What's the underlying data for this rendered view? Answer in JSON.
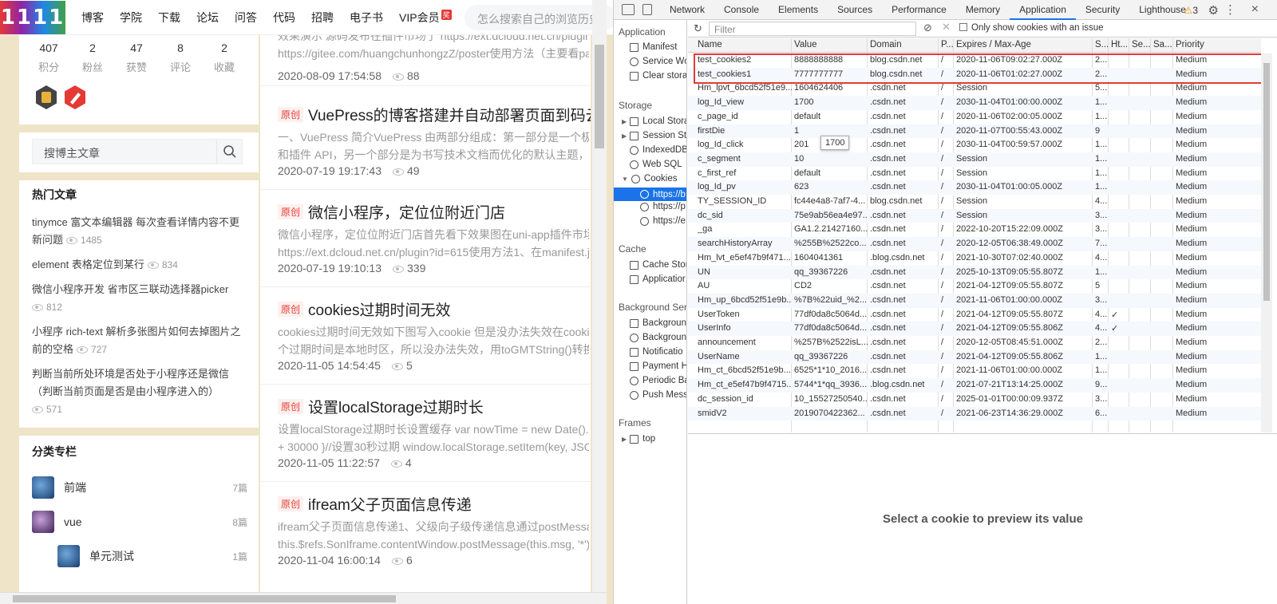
{
  "blog": {
    "logo": "1111",
    "nav": [
      "博客",
      "学院",
      "下载",
      "论坛",
      "问答",
      "代码",
      "招聘",
      "电子书",
      "VIP会员"
    ],
    "vip_badge": "奖",
    "search_placeholder": "怎么搜索自己的浏览历史",
    "stats": [
      {
        "num": "407",
        "label": "积分"
      },
      {
        "num": "2",
        "label": "粉丝"
      },
      {
        "num": "47",
        "label": "获赞"
      },
      {
        "num": "8",
        "label": "评论"
      },
      {
        "num": "2",
        "label": "收藏"
      }
    ],
    "author_search_placeholder": "搜博主文章",
    "hot_title": "热门文章",
    "hot": [
      {
        "title": "tinymce 富文本编辑器 每次查看详情内容不更新问题",
        "views": "1485"
      },
      {
        "title": "element 表格定位到某行",
        "views": "834"
      },
      {
        "title": "微信小程序开发 省市区三联动选择器picker",
        "views": "812"
      },
      {
        "title": "小程序 rich-text 解析多张图片如何去掉图片之前的空格",
        "views": "727"
      },
      {
        "title": "判断当前所处环境是否处于小程序还是微信（判断当前页面是否是由小程序进入的）",
        "views": "571"
      }
    ],
    "cat_title": "分类专栏",
    "cats": [
      {
        "name": "前端",
        "count": "7篇"
      },
      {
        "name": "vue",
        "count": "8篇"
      },
      {
        "name": "单元测试",
        "count": "1篇"
      }
    ],
    "original_tag": "原创",
    "articles": [
      {
        "title": "",
        "desc1": "效果演示 源码发布在插件市场了 https://ext.dcloud.net.cn/plugin",
        "desc2": "https://gitee.com/huangchunhongzZ/poster使用方法（主要看pa",
        "date": "2020-08-09 17:54:58",
        "views": "88"
      },
      {
        "title": "VuePress的博客搭建并自动部署页面到码云",
        "desc1": "一、VuePress 简介VuePress 由两部分组成：第一部分是一个极",
        "desc2": "和插件 API，另一个部分是为书写技术文档而优化的默认主题，1",
        "date": "2020-07-19 19:17:43",
        "views": "49"
      },
      {
        "title": "微信小程序，定位位附近门店",
        "desc1": "微信小程序，定位位附近门店首先看下效果图在uni-app插件市场",
        "desc2": "https://ext.dcloud.net.cn/plugin?id=615使用方法1、在manifest.js",
        "date": "2020-07-19 19:10:13",
        "views": "339"
      },
      {
        "title": "cookies过期时间无效",
        "desc1": "cookies过期时间无效如下图写入cookie 但是没办法失效在cookie",
        "desc2": "个过期时间是本地时区，所以没办法失效，用toGMTString()转换",
        "date": "2020-11-05 14:54:45",
        "views": "5"
      },
      {
        "title": "设置localStorage过期时长",
        "desc1": "设置localStorage过期时长设置缓存 var nowTime = new Date().g",
        "desc2": "+ 30000 }//设置30秒过期 window.localStorage.setItem(key, JSO",
        "date": "2020-11-05 11:22:57",
        "views": "4"
      },
      {
        "title": "ifream父子页面信息传递",
        "desc1": "ifream父子页面信息传递1、父级向子级传递信息通过postMessa",
        "desc2": "this.$refs.SonIframe.contentWindow.postMessage(this.msg, '*')",
        "date": "2020-11-04 16:00:14",
        "views": "6"
      }
    ]
  },
  "devtools": {
    "tabs": [
      "Network",
      "Console",
      "Elements",
      "Sources",
      "Performance",
      "Memory",
      "Application",
      "Security",
      "Lighthouse"
    ],
    "selected_tab": "Application",
    "warnings": "3",
    "sidebar": {
      "application": "Application",
      "manifest": "Manifest",
      "service_workers": "Service Wo",
      "clear_storage": "Clear stora",
      "storage": "Storage",
      "local_storage": "Local Stora",
      "session_storage": "Session Sto",
      "indexeddb": "IndexedDB",
      "websql": "Web SQL",
      "cookies": "Cookies",
      "cookie_site1": "https://b",
      "cookie_site2": "https://p",
      "cookie_site3": "https://e",
      "cache": "Cache",
      "cache_storage": "Cache Stor",
      "app_cache": "Applicatior",
      "background": "Background Servi",
      "bg_fetch": "Backgroun",
      "bg_sync": "Backgroun",
      "notifications": "Notificatio",
      "payment": "Payment H",
      "periodic": "Periodic Ba",
      "push": "Push Messa",
      "frames": "Frames",
      "top": "top"
    },
    "filter_placeholder": "Filter",
    "only_issue": "Only show cookies with an issue",
    "columns": [
      "Name",
      "Value",
      "Domain",
      "P...",
      "Expires / Max-Age",
      "S...",
      "Ht...",
      "Se...",
      "Sa...",
      "Priority"
    ],
    "cookies": [
      [
        "test_cookies2",
        "8888888888",
        "blog.csdn.net",
        "/",
        "2020-11-06T09:02:27.000Z",
        "2...",
        "",
        "",
        "",
        "Medium"
      ],
      [
        "test_cookies1",
        "7777777777",
        "blog.csdn.net",
        "/",
        "2020-11-06T01:02:27.000Z",
        "2...",
        "",
        "",
        "",
        "Medium"
      ],
      [
        "Hm_lpvt_6bcd52f51e9...",
        "1604624406",
        ".csdn.net",
        "/",
        "Session",
        "5...",
        "",
        "",
        "",
        "Medium"
      ],
      [
        "log_Id_view",
        "1700",
        ".csdn.net",
        "/",
        "2030-11-04T01:00:00.000Z",
        "1...",
        "",
        "",
        "",
        "Medium"
      ],
      [
        "c_page_id",
        "default",
        ".csdn.net",
        "/",
        "2020-11-06T02:00:05.000Z",
        "1...",
        "",
        "",
        "",
        "Medium"
      ],
      [
        "firstDie",
        "1",
        ".csdn.net",
        "/",
        "2020-11-07T00:55:43.000Z",
        "9",
        "",
        "",
        "",
        "Medium"
      ],
      [
        "log_Id_click",
        "201",
        ".csdn.net",
        "/",
        "2030-11-04T00:59:57.000Z",
        "1...",
        "",
        "",
        "",
        "Medium"
      ],
      [
        "c_segment",
        "10",
        ".csdn.net",
        "/",
        "Session",
        "1...",
        "",
        "",
        "",
        "Medium"
      ],
      [
        "c_first_ref",
        "default",
        ".csdn.net",
        "/",
        "Session",
        "1...",
        "",
        "",
        "",
        "Medium"
      ],
      [
        "log_Id_pv",
        "623",
        ".csdn.net",
        "/",
        "2030-11-04T01:00:05.000Z",
        "1...",
        "",
        "",
        "",
        "Medium"
      ],
      [
        "TY_SESSION_ID",
        "fc44e4a8-7af7-4...",
        "blog.csdn.net",
        "/",
        "Session",
        "4...",
        "",
        "",
        "",
        "Medium"
      ],
      [
        "dc_sid",
        "75e9ab56ea4e97...",
        ".csdn.net",
        "/",
        "Session",
        "3...",
        "",
        "",
        "",
        "Medium"
      ],
      [
        "_ga",
        "GA1.2.21427160...",
        ".csdn.net",
        "/",
        "2022-10-20T15:22:09.000Z",
        "3...",
        "",
        "",
        "",
        "Medium"
      ],
      [
        "searchHistoryArray",
        "%255B%2522co...",
        ".csdn.net",
        "/",
        "2020-12-05T06:38:49.000Z",
        "7...",
        "",
        "",
        "",
        "Medium"
      ],
      [
        "Hm_lvt_e5ef47b9f471...",
        "1604041361",
        ".blog.csdn.net",
        "/",
        "2021-10-30T07:02:40.000Z",
        "4...",
        "",
        "",
        "",
        "Medium"
      ],
      [
        "UN",
        "qq_39367226",
        ".csdn.net",
        "/",
        "2025-10-13T09:05:55.807Z",
        "1...",
        "",
        "",
        "",
        "Medium"
      ],
      [
        "AU",
        "CD2",
        ".csdn.net",
        "/",
        "2021-04-12T09:05:55.807Z",
        "5",
        "",
        "",
        "",
        "Medium"
      ],
      [
        "Hm_up_6bcd52f51e9b...",
        "%7B%22uid_%2...",
        ".csdn.net",
        "/",
        "2021-11-06T01:00:00.000Z",
        "3...",
        "",
        "",
        "",
        "Medium"
      ],
      [
        "UserToken",
        "77df0da8c5064d...",
        ".csdn.net",
        "/",
        "2021-04-12T09:05:55.807Z",
        "4...",
        "✓",
        "",
        "",
        "Medium"
      ],
      [
        "UserInfo",
        "77df0da8c5064d...",
        ".csdn.net",
        "/",
        "2021-04-12T09:05:55.806Z",
        "4...",
        "✓",
        "",
        "",
        "Medium"
      ],
      [
        "announcement",
        "%257B%2522isL...",
        ".csdn.net",
        "/",
        "2020-12-05T08:45:51.000Z",
        "2...",
        "",
        "",
        "",
        "Medium"
      ],
      [
        "UserName",
        "qq_39367226",
        ".csdn.net",
        "/",
        "2021-04-12T09:05:55.806Z",
        "1...",
        "",
        "",
        "",
        "Medium"
      ],
      [
        "Hm_ct_6bcd52f51e9b...",
        "6525*1*10_2016...",
        ".csdn.net",
        "/",
        "2021-11-06T01:00:00.000Z",
        "1...",
        "",
        "",
        "",
        "Medium"
      ],
      [
        "Hm_ct_e5ef47b9f4715...",
        "5744*1*qq_3936...",
        ".blog.csdn.net",
        "/",
        "2021-07-21T13:14:25.000Z",
        "9...",
        "",
        "",
        "",
        "Medium"
      ],
      [
        "dc_session_id",
        "10_15527250540...",
        ".csdn.net",
        "/",
        "2025-01-01T00:00:09.937Z",
        "3...",
        "",
        "",
        "",
        "Medium"
      ],
      [
        "smidV2",
        "2019070422362...",
        ".csdn.net",
        "/",
        "2021-06-23T14:36:29.000Z",
        "6...",
        "",
        "",
        "",
        "Medium"
      ]
    ],
    "tooltip": "1700",
    "preview_text": "Select a cookie to preview its value"
  }
}
